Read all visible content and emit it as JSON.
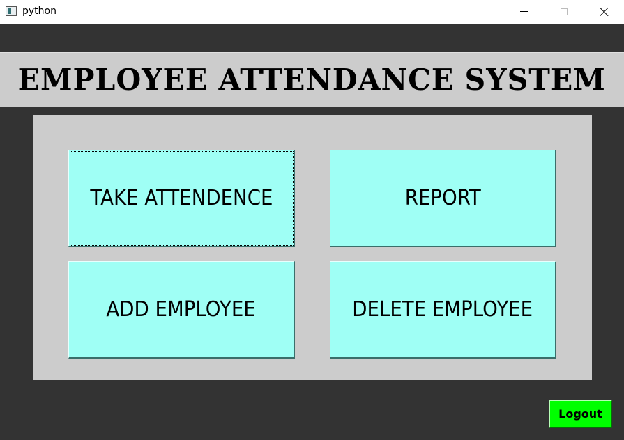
{
  "window": {
    "title": "python",
    "icons": {
      "app": "app-window-icon",
      "minimize": "minimize-icon",
      "maximize": "maximize-icon",
      "close": "close-icon"
    }
  },
  "header": {
    "title": "EMPLOYEE ATTENDANCE SYSTEM"
  },
  "menu": {
    "take_attendance_label": "TAKE ATTENDENCE",
    "report_label": "REPORT",
    "add_employee_label": "ADD EMPLOYEE",
    "delete_employee_label": "DELETE EMPLOYEE"
  },
  "footer": {
    "logout_label": "Logout"
  },
  "colors": {
    "background": "#333333",
    "header_bg": "#cccccc",
    "panel_bg": "#cccccc",
    "menu_button_bg": "#9ffff5",
    "logout_bg": "#00ff00"
  }
}
